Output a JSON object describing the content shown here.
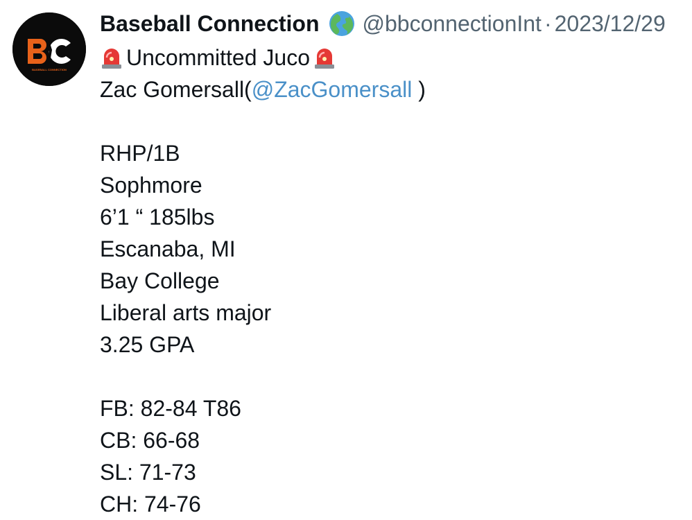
{
  "profile": {
    "avatar_logo_text": "BC",
    "avatar_logo_subtext": "BASEBALL CONNECTION"
  },
  "header": {
    "display_name": "Baseball Connection",
    "display_name_emoji": "globe-europe-africa-icon",
    "handle": "@bbconnectionInt",
    "separator": "·",
    "date": "2023/12/29"
  },
  "tweet": {
    "headline_icon": "siren-icon",
    "headline": "Uncommitted Juco",
    "player_name_prefix": "Zac Gomersall(",
    "mention": "@ZacGomersall",
    "player_name_suffix": " )",
    "profile_lines": [
      "RHP/1B",
      "Sophmore",
      "6’1 “ 185lbs",
      "Escanaba, MI",
      "Bay College",
      "Liberal arts major",
      "3.25 GPA"
    ],
    "pitch_lines": [
      "FB: 82-84 T86",
      "CB: 66-68",
      "SL: 71-73",
      "CH: 74-76"
    ]
  },
  "colors": {
    "text": "#0f1419",
    "muted": "#536471",
    "mention": "#4a90c8",
    "logo_orange": "#e8621a",
    "avatar_bg": "#0b0b0b"
  }
}
